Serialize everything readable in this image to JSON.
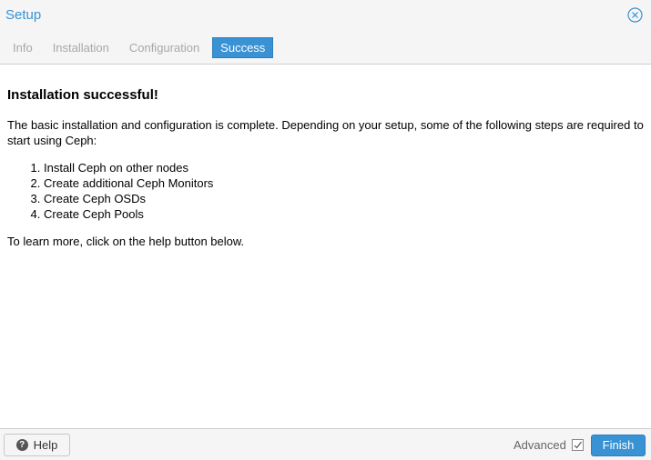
{
  "window": {
    "title": "Setup"
  },
  "tabs": [
    {
      "label": "Info",
      "active": false
    },
    {
      "label": "Installation",
      "active": false
    },
    {
      "label": "Configuration",
      "active": false
    },
    {
      "label": "Success",
      "active": true
    }
  ],
  "content": {
    "heading": "Installation successful!",
    "intro": "The basic installation and configuration is complete. Depending on your setup, some of the following steps are required to start using Ceph:",
    "steps": [
      "Install Ceph on other nodes",
      "Create additional Ceph Monitors",
      "Create Ceph OSDs",
      "Create Ceph Pools"
    ],
    "more": "To learn more, click on the help button below."
  },
  "footer": {
    "help_label": "Help",
    "advanced_label": "Advanced",
    "advanced_checked": true,
    "finish_label": "Finish"
  },
  "colors": {
    "accent": "#3892d4",
    "tab_inactive": "#a8a8a8",
    "panel_bg": "#f5f5f5"
  },
  "icons": {
    "close": "close-circle-icon",
    "help": "question-circle-icon",
    "checkbox": "checkmark-icon"
  }
}
